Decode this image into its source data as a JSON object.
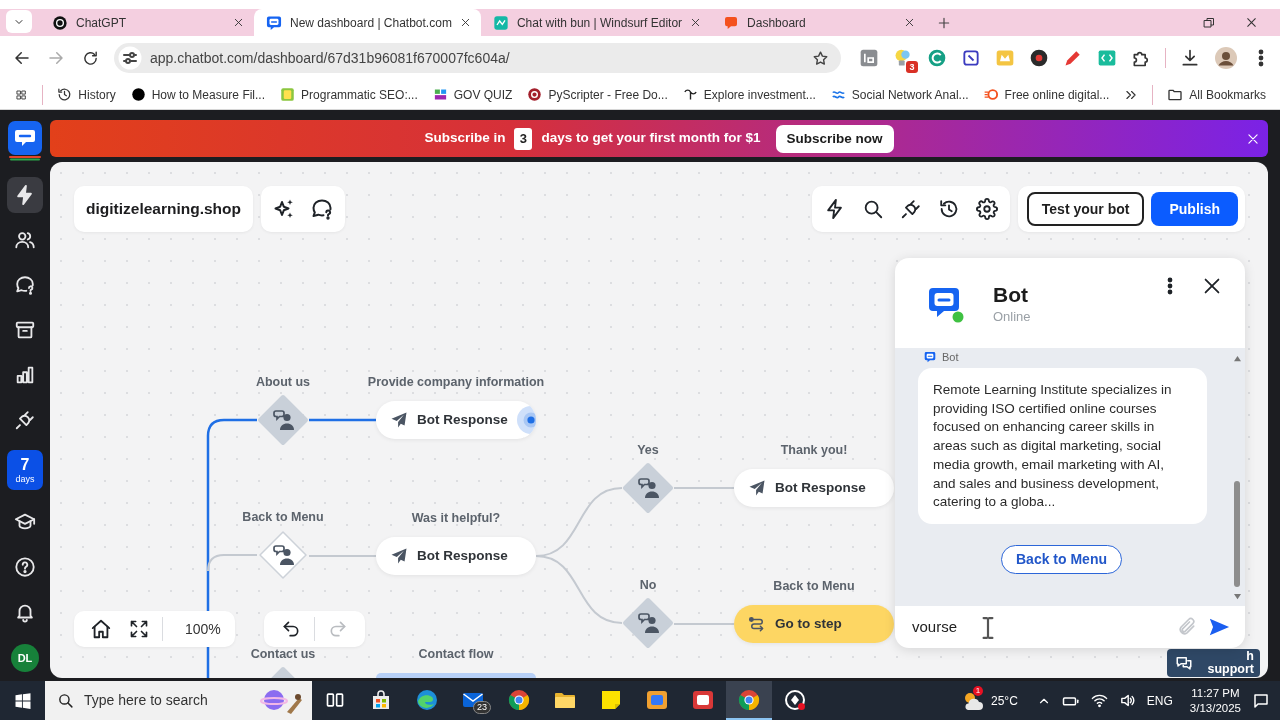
{
  "browser": {
    "tabs": [
      {
        "title": "ChatGPT",
        "selected": false
      },
      {
        "title": "New dashboard | Chatbot.com",
        "selected": true
      },
      {
        "title": "Chat with bun | Windsurf Editor",
        "selected": false
      },
      {
        "title": "Dashboard",
        "selected": false
      }
    ],
    "url": "app.chatbot.com/dashboard/67d31b96081f670007fc604a/",
    "extension_badge": "3",
    "bookmarks": [
      "History",
      "How to Measure Fil...",
      "Programmatic SEO:...",
      "GOV QUIZ",
      "PyScripter - Free Do...",
      "Explore investment...",
      "Social Network Anal...",
      "Free online digital..."
    ],
    "all_bookmarks": "All Bookmarks"
  },
  "sidebar": {
    "items": [
      {
        "selected": true
      },
      {
        "selected": false
      },
      {
        "selected": false
      },
      {
        "selected": false
      },
      {
        "selected": false
      },
      {
        "selected": false
      }
    ],
    "trial": {
      "count": "7",
      "unit": "days"
    },
    "bottom_items": [
      {
        "selected": false
      },
      {
        "selected": false
      },
      {
        "selected": false
      }
    ],
    "avatar": "DL"
  },
  "banner": {
    "lead": "Subscribe in",
    "days": "3",
    "tail": "days to get your first month for $1",
    "button": "Subscribe now"
  },
  "editor": {
    "bot_name": "digitizelearning.shop",
    "test_button": "Test your bot",
    "publish_button": "Publish",
    "zoom": "100%",
    "undo": {
      "disabled": false
    },
    "redo": {
      "disabled": true
    },
    "flow": {
      "trunk_active": true,
      "nodes": [
        {
          "kind": "user_input",
          "caption": "About us",
          "filled": true,
          "path_active": true,
          "children": [
            {
              "kind": "bot_response",
              "caption": "Provide company information",
              "text": "Bot Response",
              "selected": true,
              "path_active": true
            }
          ]
        },
        {
          "kind": "user_input",
          "caption": "Back to Menu",
          "filled": false,
          "path_active": false,
          "children": [
            {
              "kind": "bot_response",
              "caption": "Was it helpful?",
              "text": "Bot Response",
              "selected": false,
              "path_active": false,
              "children": [
                {
                  "kind": "user_input",
                  "caption": "Yes",
                  "filled": true,
                  "path_active": false,
                  "children": [
                    {
                      "kind": "bot_response",
                      "caption": "Thank you!",
                      "text": "Bot Response",
                      "selected": false,
                      "path_active": false
                    }
                  ]
                },
                {
                  "kind": "user_input",
                  "caption": "No",
                  "filled": true,
                  "path_active": false,
                  "children": [
                    {
                      "kind": "go_to_step",
                      "caption": "Back to Menu",
                      "text": "Go to step",
                      "selected": false,
                      "path_active": false
                    }
                  ]
                }
              ]
            }
          ]
        },
        {
          "kind": "user_input",
          "caption": "Contact us",
          "filled": true,
          "children": [
            {
              "kind": "flow_link",
              "caption": "Contact flow"
            }
          ]
        }
      ]
    }
  },
  "chat_preview": {
    "title": "Bot",
    "status": "Online",
    "online": true,
    "sender": "Bot",
    "message": "Remote Learning Institute specializes in providing ISO certified online courses focused on enhancing career skills in areas such as digital marketing, social media growth, email marketing with AI, and sales and business development, catering to a globa...",
    "quick_reply": "Back to Menu",
    "input_value": "vourse"
  },
  "support_button": {
    "lines": [
      "h",
      "support"
    ]
  },
  "taskbar": {
    "search_placeholder": "Type here to search",
    "apps": [
      {
        "active": false
      },
      {
        "active": false
      },
      {
        "active": false,
        "badge": "23"
      },
      {
        "active": false
      },
      {
        "active": false
      },
      {
        "active": false
      },
      {
        "active": false
      },
      {
        "active": false
      },
      {
        "active": true
      },
      {
        "active": false
      }
    ],
    "weather_badge": "1",
    "temperature": "25°C",
    "language": "ENG",
    "time": "11:27 PM",
    "date": "3/13/2025"
  }
}
